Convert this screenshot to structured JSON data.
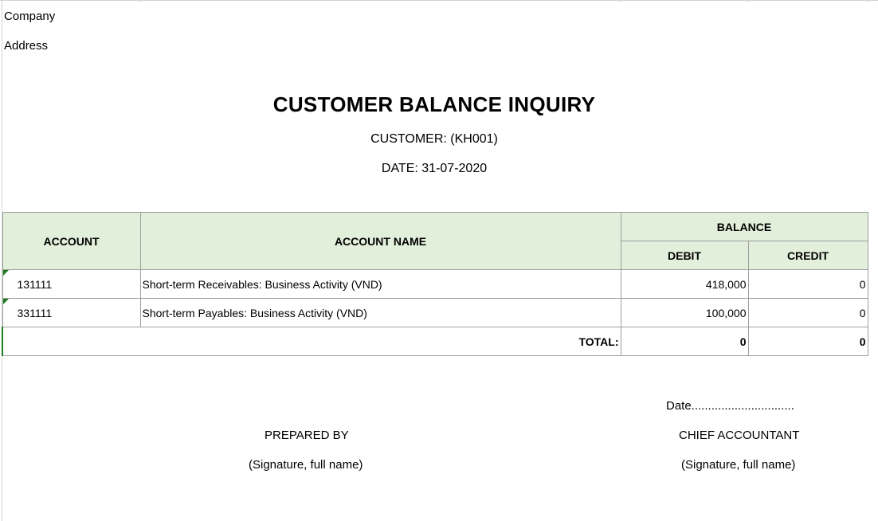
{
  "header": {
    "company_label": "Company",
    "address_label": "Address",
    "title": "CUSTOMER BALANCE INQUIRY",
    "customer_line": "CUSTOMER:  (KH001)",
    "date_line": "DATE: 31-07-2020"
  },
  "table": {
    "columns": {
      "account": "ACCOUNT",
      "account_name": "ACCOUNT NAME",
      "balance": "BALANCE",
      "debit": "DEBIT",
      "credit": "CREDIT"
    },
    "rows": [
      {
        "account": "131111",
        "account_name": "Short-term Receivables: Business Activity (VND)",
        "debit": "418,000",
        "credit": "0"
      },
      {
        "account": "331111",
        "account_name": "Short-term Payables: Business Activity (VND)",
        "debit": "100,000",
        "credit": "0"
      }
    ],
    "total": {
      "label": "TOTAL:",
      "debit": "0",
      "credit": "0"
    }
  },
  "signatures": {
    "date_line": "Date...............................",
    "prepared_by": "PREPARED BY",
    "prepared_by_sig": "(Signature, full name)",
    "chief_accountant": "CHIEF ACCOUNTANT",
    "chief_accountant_sig": "(Signature, full name)"
  },
  "colors": {
    "header_fill": "#e2efda",
    "error_flag": "#1e7b1e",
    "grid_border": "#9e9e9e"
  }
}
